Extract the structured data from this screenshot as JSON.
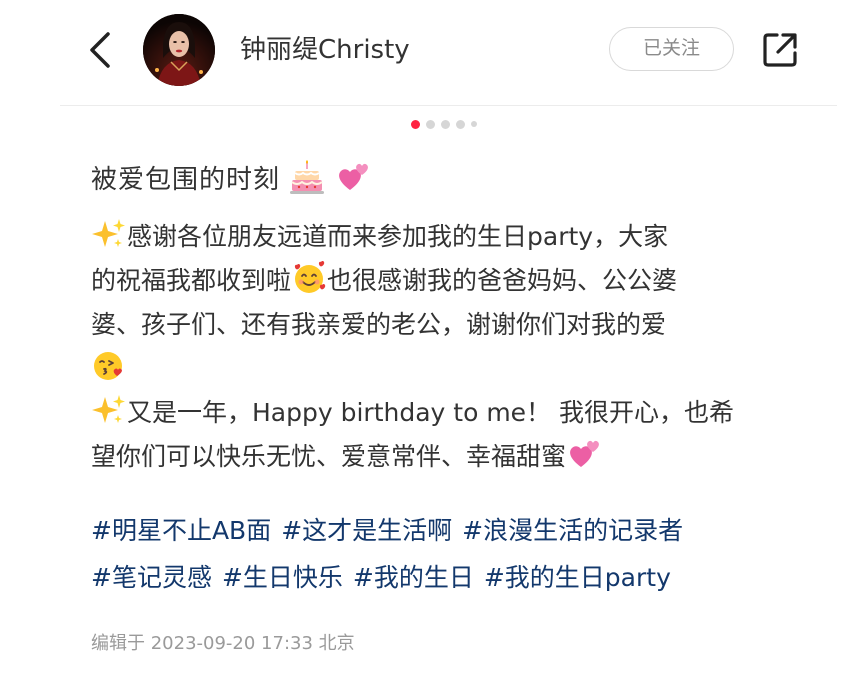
{
  "header": {
    "back_icon": "chevron-left-icon",
    "author_name": "钟丽缇Christy",
    "follow_label": "已关注",
    "share_icon": "share-external-icon"
  },
  "carousel": {
    "total": 5,
    "active_index": 0,
    "active_color": "#ff2442"
  },
  "post": {
    "title_text": "被爱包围的时刻",
    "title_emojis": [
      "birthday-cake",
      "two-hearts"
    ],
    "body_lines": [
      "感谢各位朋友远道而来参加我的生日party，大家",
      "的祝福我都收到啦",
      "也很感谢我的爸爸妈妈、公公婆",
      "婆、孩子们、还有我亲爱的老公，谢谢你们对我的爱",
      "又是一年，Happy birthday to me！ 我很开心，也希",
      "望你们可以快乐无忧、爱意常伴、幸福甜蜜"
    ],
    "body_emojis": [
      "sparkles",
      "smiling-face-with-hearts",
      "face-blowing-kiss",
      "sparkles",
      "two-hearts"
    ],
    "tags": [
      "#明星不止AB面",
      "#这才是生活啊",
      "#浪漫生活的记录者",
      "#笔记灵感",
      "#生日快乐",
      "#我的生日",
      "#我的生日party"
    ],
    "edited_label": "编辑于 2023-09-20 17:33 北京"
  },
  "colors": {
    "tag_color": "#13386c",
    "brand_red": "#ff2442",
    "meta_gray": "#9a9a9a"
  }
}
